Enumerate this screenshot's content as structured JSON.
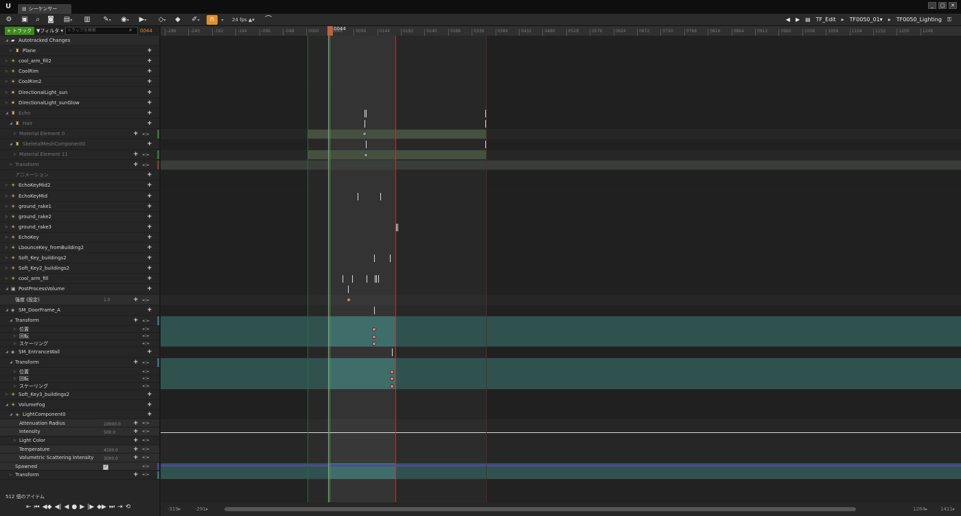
{
  "window": {
    "tab_title": "シーケンサー",
    "logo": "U",
    "controls": [
      "_",
      "□",
      "✕"
    ]
  },
  "toolbar": {
    "fps": "24 fps",
    "breadcrumbs": [
      "TF_Edit",
      "TF0050_01▾",
      "TF0050_Lighting"
    ],
    "accent_color": "#e0902a"
  },
  "tracks_toolbar": {
    "add_track": "+ トラック ▾",
    "filter": "▼フィルタ ▾",
    "search_placeholder": "トラックを検索",
    "current_frame": "0044"
  },
  "tree": [
    {
      "name": "Autotracked Changes",
      "icon": "folder-icon",
      "indent": 1,
      "expander": "◢",
      "plus": false,
      "kind": "folder"
    },
    {
      "name": "Plane",
      "icon": "actor-icon",
      "indent": 2,
      "expander": "▷",
      "plus": true
    },
    {
      "name": "cool_arm_fill2",
      "icon": "light-icon",
      "indent": 1,
      "expander": "▷",
      "plus": true
    },
    {
      "name": "CoolRim",
      "icon": "light-icon",
      "indent": 1,
      "expander": "▷",
      "plus": true
    },
    {
      "name": "CoolRim2",
      "icon": "light-icon",
      "indent": 1,
      "expander": "▷",
      "plus": true
    },
    {
      "name": "DirectionalLight_sun",
      "icon": "sun-icon",
      "indent": 1,
      "expander": "▷",
      "plus": true
    },
    {
      "name": "DirectionalLight_sunGlow",
      "icon": "sun-icon",
      "indent": 1,
      "expander": "▷",
      "plus": true
    },
    {
      "name": "Echo",
      "icon": "actor-icon",
      "indent": 1,
      "expander": "◢",
      "plus": true,
      "dim": true
    },
    {
      "name": "Hair",
      "icon": "actor-icon",
      "indent": 2,
      "expander": "◢",
      "plus": true,
      "dim": true
    },
    {
      "name": "Material Element 0",
      "icon": "",
      "indent": 3,
      "expander": "▷",
      "plus": true,
      "keys": true,
      "dim": true,
      "strip": "#3a6b3a"
    },
    {
      "name": "SkeletalMeshComponent0",
      "icon": "actor-icon",
      "indent": 2,
      "expander": "◢",
      "plus": true,
      "dim": true
    },
    {
      "name": "Material Element 11",
      "icon": "",
      "indent": 3,
      "expander": "▷",
      "plus": true,
      "keys": true,
      "dim": true,
      "strip": "#3a6b3a"
    },
    {
      "name": "Transform",
      "icon": "",
      "indent": 2,
      "expander": "▷",
      "plus": true,
      "keys": true,
      "dim": true,
      "strip": "#6b3a3a"
    },
    {
      "name": "アニメーション",
      "icon": "",
      "indent": 2,
      "expander": "",
      "plus": true,
      "dim": true
    },
    {
      "name": "EchoKeyMid2",
      "icon": "light-icon",
      "indent": 1,
      "expander": "▷",
      "plus": true
    },
    {
      "name": "EchoKeyMid",
      "icon": "light-icon",
      "indent": 1,
      "expander": "▷",
      "plus": true
    },
    {
      "name": "ground_rake1",
      "icon": "light-icon",
      "indent": 1,
      "expander": "▷",
      "plus": true
    },
    {
      "name": "ground_rake2",
      "icon": "light-icon",
      "indent": 1,
      "expander": "▷",
      "plus": true
    },
    {
      "name": "ground_rake3",
      "icon": "light-icon",
      "indent": 1,
      "expander": "▷",
      "plus": true
    },
    {
      "name": "EchoKey",
      "icon": "light-icon",
      "indent": 1,
      "expander": "▷",
      "plus": true
    },
    {
      "name": "LbounceKey_fromBuilding2",
      "icon": "light-icon",
      "indent": 1,
      "expander": "▷",
      "plus": true
    },
    {
      "name": "Soft_Key_buildings2",
      "icon": "light-icon",
      "indent": 1,
      "expander": "▷",
      "plus": true
    },
    {
      "name": "Soft_Key2_buildings2",
      "icon": "light-icon",
      "indent": 1,
      "expander": "▷",
      "plus": true
    },
    {
      "name": "cool_arm_fill",
      "icon": "light-icon",
      "indent": 1,
      "expander": "▷",
      "plus": true
    },
    {
      "name": "PostProcessVolume",
      "icon": "volume-icon",
      "indent": 1,
      "expander": "◢",
      "plus": true
    },
    {
      "name": "強度 (設定)",
      "icon": "",
      "indent": 2,
      "expander": "",
      "plus": true,
      "keys": true,
      "value": "1.0"
    },
    {
      "name": "SM_DoorFrame_A",
      "icon": "mesh-icon",
      "indent": 1,
      "expander": "◢",
      "plus": true
    },
    {
      "name": "Transform",
      "icon": "",
      "indent": 2,
      "expander": "◢",
      "plus": true,
      "keys": true,
      "strip": "#3a6b6b"
    },
    {
      "name": "位置",
      "icon": "",
      "indent": 3,
      "expander": "▷",
      "plus": false,
      "keys": true,
      "compact": true
    },
    {
      "name": "回転",
      "icon": "",
      "indent": 3,
      "expander": "▷",
      "plus": false,
      "keys": true,
      "compact": true
    },
    {
      "name": "スケーリング",
      "icon": "",
      "indent": 3,
      "expander": "▷",
      "plus": false,
      "keys": true,
      "compact": true
    },
    {
      "name": "SM_EntranceWall",
      "icon": "mesh-icon",
      "indent": 1,
      "expander": "◢",
      "plus": true
    },
    {
      "name": "Transform",
      "icon": "",
      "indent": 2,
      "expander": "◢",
      "plus": true,
      "keys": true,
      "strip": "#3a6b6b"
    },
    {
      "name": "位置",
      "icon": "",
      "indent": 3,
      "expander": "▷",
      "plus": false,
      "keys": true,
      "compact": true
    },
    {
      "name": "回転",
      "icon": "",
      "indent": 3,
      "expander": "▷",
      "plus": false,
      "keys": true,
      "compact": true
    },
    {
      "name": "スケーリング",
      "icon": "",
      "indent": 3,
      "expander": "▷",
      "plus": false,
      "keys": true,
      "compact": true
    },
    {
      "name": "Soft_Key3_buildings2",
      "icon": "light-icon",
      "indent": 1,
      "expander": "▷",
      "plus": true
    },
    {
      "name": "VolumeFog",
      "icon": "light-icon",
      "indent": 1,
      "expander": "◢",
      "plus": true
    },
    {
      "name": "LightComponent0",
      "icon": "light-icon",
      "indent": 2,
      "expander": "◢",
      "plus": true
    },
    {
      "name": "Attenuation Radius",
      "icon": "",
      "indent": 3,
      "expander": "",
      "plus": true,
      "keys": true,
      "value": "10000.0"
    },
    {
      "name": "Intensity",
      "icon": "",
      "indent": 3,
      "expander": "",
      "plus": true,
      "keys": true,
      "value": "500.0"
    },
    {
      "name": "Light Color",
      "icon": "",
      "indent": 3,
      "expander": "▷",
      "plus": true,
      "keys": true
    },
    {
      "name": "Temperature",
      "icon": "",
      "indent": 3,
      "expander": "",
      "plus": true,
      "keys": true,
      "value": "4500.0"
    },
    {
      "name": "Volumetric Scattering Intensity",
      "icon": "",
      "indent": 3,
      "expander": "",
      "plus": true,
      "keys": true,
      "value": "3000.0"
    },
    {
      "name": "Spawned",
      "icon": "",
      "indent": 2,
      "expander": "",
      "plus": false,
      "keys": true,
      "checkbox": true,
      "strip": "#3a4a8a"
    },
    {
      "name": "Transform",
      "icon": "",
      "indent": 2,
      "expander": "▷",
      "plus": true,
      "keys": true,
      "strip": "#3a6b6b"
    }
  ],
  "status": {
    "item_count": "512 個のアイテム"
  },
  "transport": [
    "⇤",
    "⏮",
    "◀◆",
    "◀|",
    "◀",
    "●",
    "▶",
    "|▶",
    "◆▶",
    "⏭",
    "⇥",
    "⟲"
  ],
  "ruler": {
    "labels": [
      "-288",
      "-240",
      "-192",
      "-144",
      "-096",
      "-048",
      "0000",
      "0048",
      "0096",
      "0144",
      "0192",
      "0240",
      "0288",
      "0336",
      "0384",
      "0432",
      "0480",
      "0528",
      "0576",
      "0624",
      "0672",
      "0720",
      "0768",
      "0816",
      "0864",
      "0912",
      "0960",
      "1008",
      "1056",
      "1104",
      "1152",
      "1200",
      "1248"
    ],
    "current_frame": "0044",
    "playhead_label": "0044"
  },
  "bottom": {
    "left_a": "-319▸",
    "left_b": "-291▸",
    "right_a": "1284▸",
    "right_b": "1411▸"
  }
}
